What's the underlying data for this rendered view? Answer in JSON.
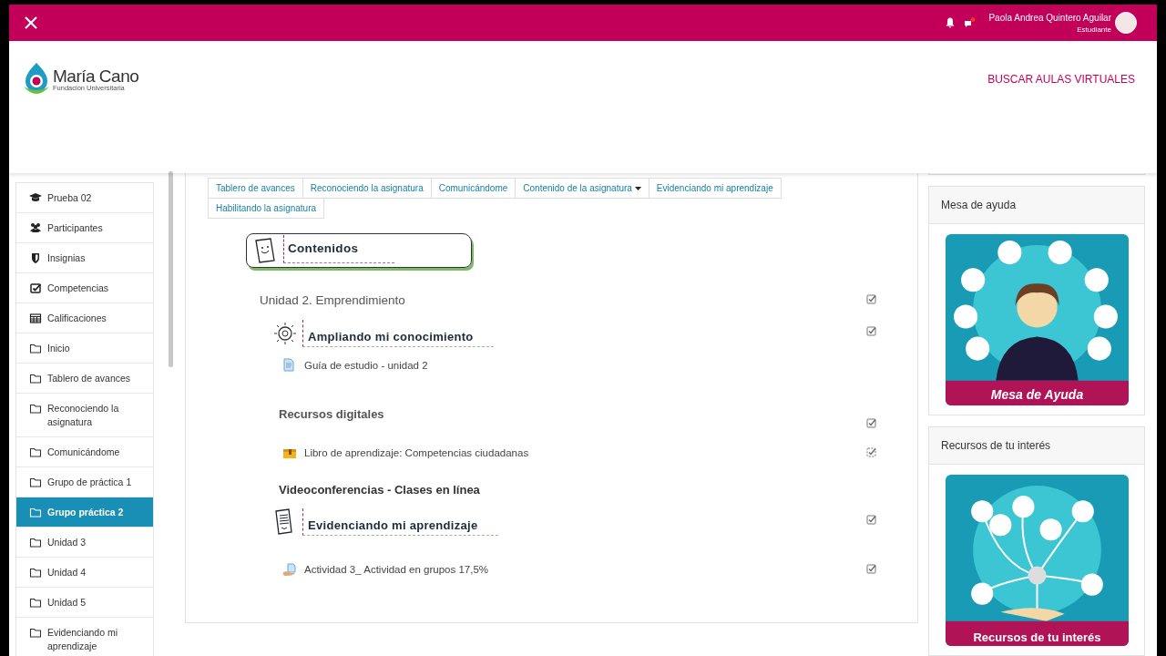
{
  "topbar": {
    "user_name": "Paola Andrea Quintero Aguilar",
    "user_role": "Estudiante",
    "unread_messages": true
  },
  "header": {
    "logo_name": "María Cano",
    "logo_subtitle": "Fundación Universitaria",
    "link": "BUSCAR AULAS VIRTUALES"
  },
  "sidebar": {
    "items": [
      {
        "label": "Prueba 02",
        "kind": "course",
        "selected": false
      },
      {
        "label": "Participantes",
        "kind": "participants",
        "selected": false
      },
      {
        "label": "Insignias",
        "kind": "badges",
        "selected": false
      },
      {
        "label": "Competencias",
        "kind": "competencies",
        "selected": false
      },
      {
        "label": "Calificaciones",
        "kind": "grades",
        "selected": false
      },
      {
        "label": "Inicio",
        "kind": "section",
        "selected": false
      },
      {
        "label": "Tablero de avances",
        "kind": "section",
        "selected": false
      },
      {
        "label": "Reconociendo la asignatura",
        "kind": "section",
        "selected": false
      },
      {
        "label": "Comunicándome",
        "kind": "section",
        "selected": false
      },
      {
        "label": "Grupo de práctica 1",
        "kind": "section",
        "selected": false
      },
      {
        "label": "Grupo práctica 2",
        "kind": "section",
        "selected": true
      },
      {
        "label": "Unidad 3",
        "kind": "section",
        "selected": false
      },
      {
        "label": "Unidad 4",
        "kind": "section",
        "selected": false
      },
      {
        "label": "Unidad 5",
        "kind": "section",
        "selected": false
      },
      {
        "label": "Evidenciando mi aprendizaje",
        "kind": "section",
        "selected": false
      }
    ]
  },
  "section_tabs": [
    {
      "label": "Tablero de avances",
      "dropdown": false
    },
    {
      "label": "Reconociendo la asignatura",
      "dropdown": false
    },
    {
      "label": "Comunicándome",
      "dropdown": false
    },
    {
      "label": "Contenido de la asignatura",
      "dropdown": true
    },
    {
      "label": "Evidenciando mi aprendizaje",
      "dropdown": false
    },
    {
      "label": "Habilitando la asignatura",
      "dropdown": false
    }
  ],
  "content": [
    {
      "kind": "title-banner",
      "text": "Contenidos"
    },
    {
      "kind": "unit",
      "text": "Unidad 2. Emprendimiento",
      "checked": true,
      "automatic": false
    },
    {
      "kind": "banner",
      "text": "Ampliando mi conocimiento",
      "checked": true,
      "automatic": false
    },
    {
      "kind": "page",
      "text": "Guía de estudio - unidad 2"
    },
    {
      "kind": "subheading",
      "text": "Recursos digitales",
      "checked": true,
      "automatic": false
    },
    {
      "kind": "book",
      "text": "Libro de aprendizaje: Competencias ciudadanas",
      "checked": true,
      "automatic": true
    },
    {
      "kind": "heading",
      "text": "Videoconferencias - Clases en línea"
    },
    {
      "kind": "banner",
      "text": "Evidenciando mi aprendizaje",
      "checked": true,
      "automatic": false
    },
    {
      "kind": "assign",
      "text": "Actividad 3_ Actividad en grupos 17,5%",
      "checked": true,
      "automatic": false
    }
  ],
  "blocks": [
    {
      "title": "Mesa de ayuda",
      "caption": "Mesa de Ayuda",
      "kind": "picture"
    },
    {
      "title": "Recursos de tu interés",
      "caption": "Recursos de tu interés",
      "kind": "picture"
    }
  ]
}
